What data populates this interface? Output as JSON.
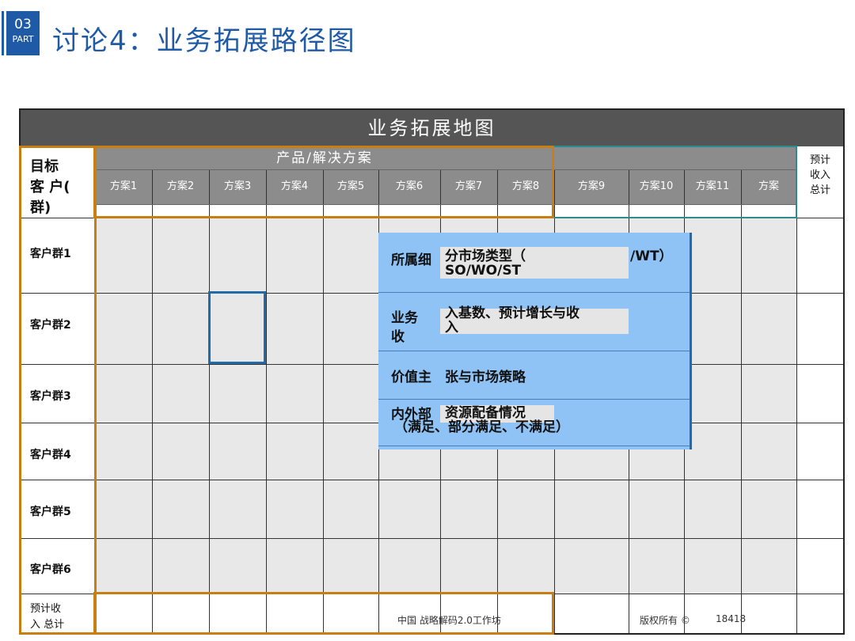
{
  "badge": {
    "number": "03",
    "part": "PART"
  },
  "title": "讨论4：业务拓展路径图",
  "table": {
    "header": "业务拓展地图",
    "target_label": "目标客 户(群)",
    "target_lines": [
      "目标",
      "客 户(",
      "群)"
    ],
    "product_label": "产品/解决方案",
    "solutions": [
      "方案1",
      "方案2",
      "方案3",
      "方案4",
      "方案5",
      "方案6",
      "方案7",
      "方案8",
      "方案9",
      "方案10",
      "方案11",
      "方案"
    ],
    "forecast_lines": [
      "预计",
      "收入",
      "总计"
    ],
    "groups": [
      "客户群1",
      "客户群2",
      "客户群3",
      "客户群4",
      "客户群5",
      "客户群6"
    ],
    "bottom_lines": [
      "预计收",
      "入 总计"
    ]
  },
  "overlay": {
    "row1_a": "所属细",
    "row1_b": "分市场类型（",
    "row1_c": "/WT）",
    "row1_d": "SO/WO/ST",
    "row2_a": "业务",
    "row2_b": "收",
    "row2_c": "入基数、预计增长与收",
    "row2_d": "入",
    "row3_a": "价值主",
    "row3_b": "张与市场策略",
    "row4_a": "内外部",
    "row4_b": "资源配备情况",
    "row4_c": "（满足、部分满足、不满足）"
  },
  "footer": {
    "left": "中国  战略解码2.0工作坊",
    "right": "版权所有 ©",
    "page": "18418"
  },
  "colors": {
    "accent": "#1f5aa6",
    "orange": "#c77f14",
    "overlay": "#8fc3f5",
    "header": "#555555"
  }
}
